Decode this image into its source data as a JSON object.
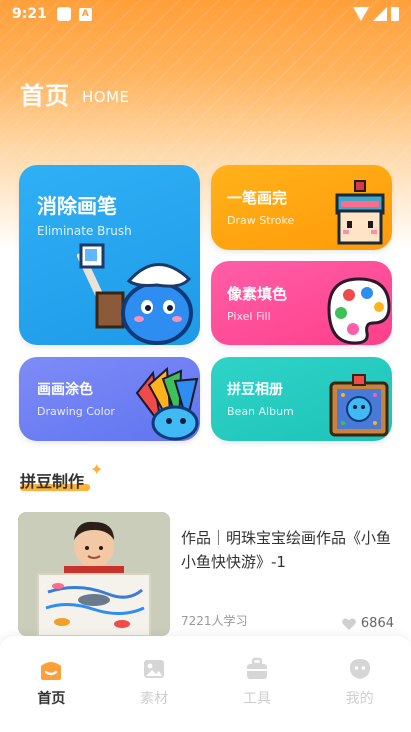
{
  "status_bar": {
    "time": "9:21"
  },
  "header": {
    "title": "首页",
    "subtitle": "HOME"
  },
  "cards": {
    "brush": {
      "title": "消除画笔",
      "subtitle": "Eliminate Brush",
      "color": "#2fb0f5"
    },
    "stroke": {
      "title": "一笔画完",
      "subtitle": "Draw Stroke",
      "color": "#ffb21b"
    },
    "fill": {
      "title": "像素填色",
      "subtitle": "Pixel Fill",
      "color": "#ff5ea8"
    },
    "color": {
      "title": "画画涂色",
      "subtitle": "Drawing Color",
      "color": "#7f8cf7"
    },
    "album": {
      "title": "拼豆相册",
      "subtitle": "Bean Album",
      "color": "#2fd3c8"
    }
  },
  "section": {
    "title": "拼豆制作",
    "star_icon": "sparkle-icon"
  },
  "work": {
    "title": "作品｜明珠宝宝绘画作品《小鱼小鱼快快游》-1",
    "learners": "7221人学习",
    "likes": "6864"
  },
  "tabs": [
    {
      "label": "首页",
      "icon": "home-icon",
      "active": true
    },
    {
      "label": "素材",
      "icon": "image-icon",
      "active": false
    },
    {
      "label": "工具",
      "icon": "toolbox-icon",
      "active": false
    },
    {
      "label": "我的",
      "icon": "profile-icon",
      "active": false
    }
  ],
  "colors": {
    "accent": "#ff9f3a",
    "tab_inactive": "#cfcfcf"
  }
}
